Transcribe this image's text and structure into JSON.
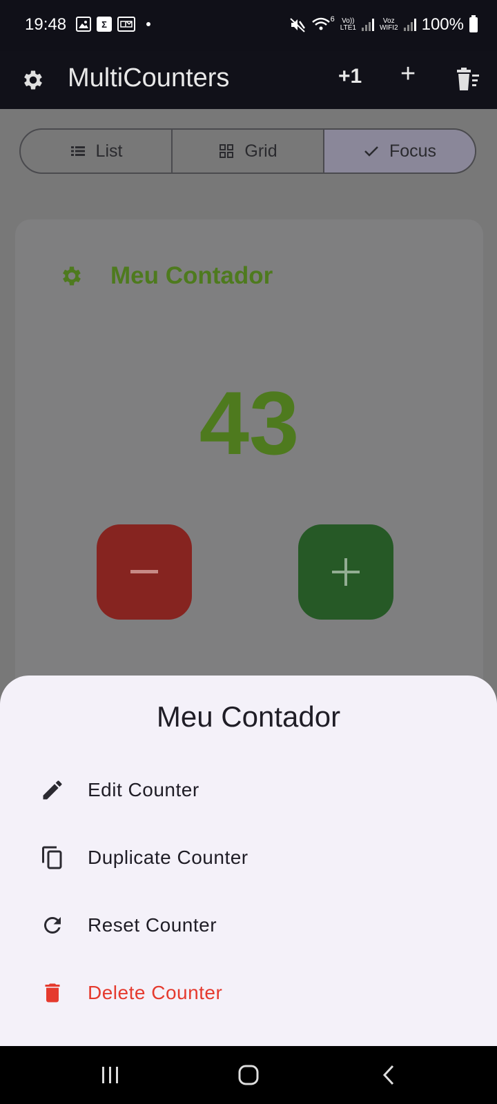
{
  "status_bar": {
    "time": "19:48",
    "battery_text": "100%",
    "lte_label": "LTE1",
    "volte_label": "Vo))",
    "voz_label": "Voz",
    "wifi_label": "WIFI2",
    "wifi_num": "6"
  },
  "app_bar": {
    "title": "MultiCounters",
    "plus_one_label": "+1",
    "add_label": "+"
  },
  "view_toggle": {
    "list": "List",
    "grid": "Grid",
    "focus": "Focus",
    "selected": "Focus"
  },
  "counter": {
    "name": "Meu Contador",
    "value": "43",
    "accent_color": "#4e7a1e",
    "decrement_color": "#862420",
    "increment_color": "#265926"
  },
  "sheet": {
    "title": "Meu Contador",
    "items": [
      {
        "label": "Edit Counter",
        "icon": "pencil-icon"
      },
      {
        "label": "Duplicate Counter",
        "icon": "copy-icon"
      },
      {
        "label": "Reset Counter",
        "icon": "refresh-icon"
      },
      {
        "label": "Delete Counter",
        "icon": "trash-icon"
      }
    ],
    "danger_color": "#e53a2e"
  }
}
